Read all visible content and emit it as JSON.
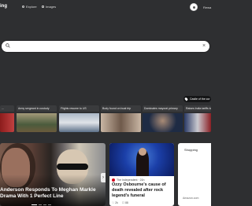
{
  "header": {
    "logo": "ing",
    "nav": [
      {
        "label": "Explore",
        "icon": "compass-icon"
      },
      {
        "label": "Images",
        "icon": "image-icon"
      }
    ],
    "right_label": "Rewa"
  },
  "search": {
    "placeholder": "",
    "value": "",
    "clear_glyph": "×"
  },
  "location_chip": {
    "label": "Castle of the cor"
  },
  "trending": [
    {
      "label": "...",
      "colors": [
        "#8c1c1c",
        "#c04040"
      ]
    },
    {
      "label": "Army sergeant in custody",
      "colors": [
        "#4b5b3c",
        "#a39a7a"
      ]
    },
    {
      "label": "Flights resume to US",
      "colors": [
        "#aab7c6",
        "#5c7088"
      ]
    },
    {
      "label": "Body found on boat trip",
      "colors": [
        "#6f5a4b",
        "#c9b6a4"
      ]
    },
    {
      "label": "Dominates mayoral primary",
      "colors": [
        "#1e2b44",
        "#a98b76"
      ]
    },
    {
      "label": "Raises India tariffs to",
      "colors": [
        "#2a3a66",
        "#c9c9cf"
      ]
    }
  ],
  "hero": {
    "title": "Anderson Responds To Meghan Markle Drama With 1 Perfect Line",
    "next_glyph": "›"
  },
  "card2": {
    "source": "The Independent · 21h",
    "title": "Ozzy Osbourne's cause of death revealed after rock legend's funeral",
    "likes": "2k",
    "comments": "88"
  },
  "card3": {
    "title": "Shopping",
    "footer": "Amazon.com"
  }
}
